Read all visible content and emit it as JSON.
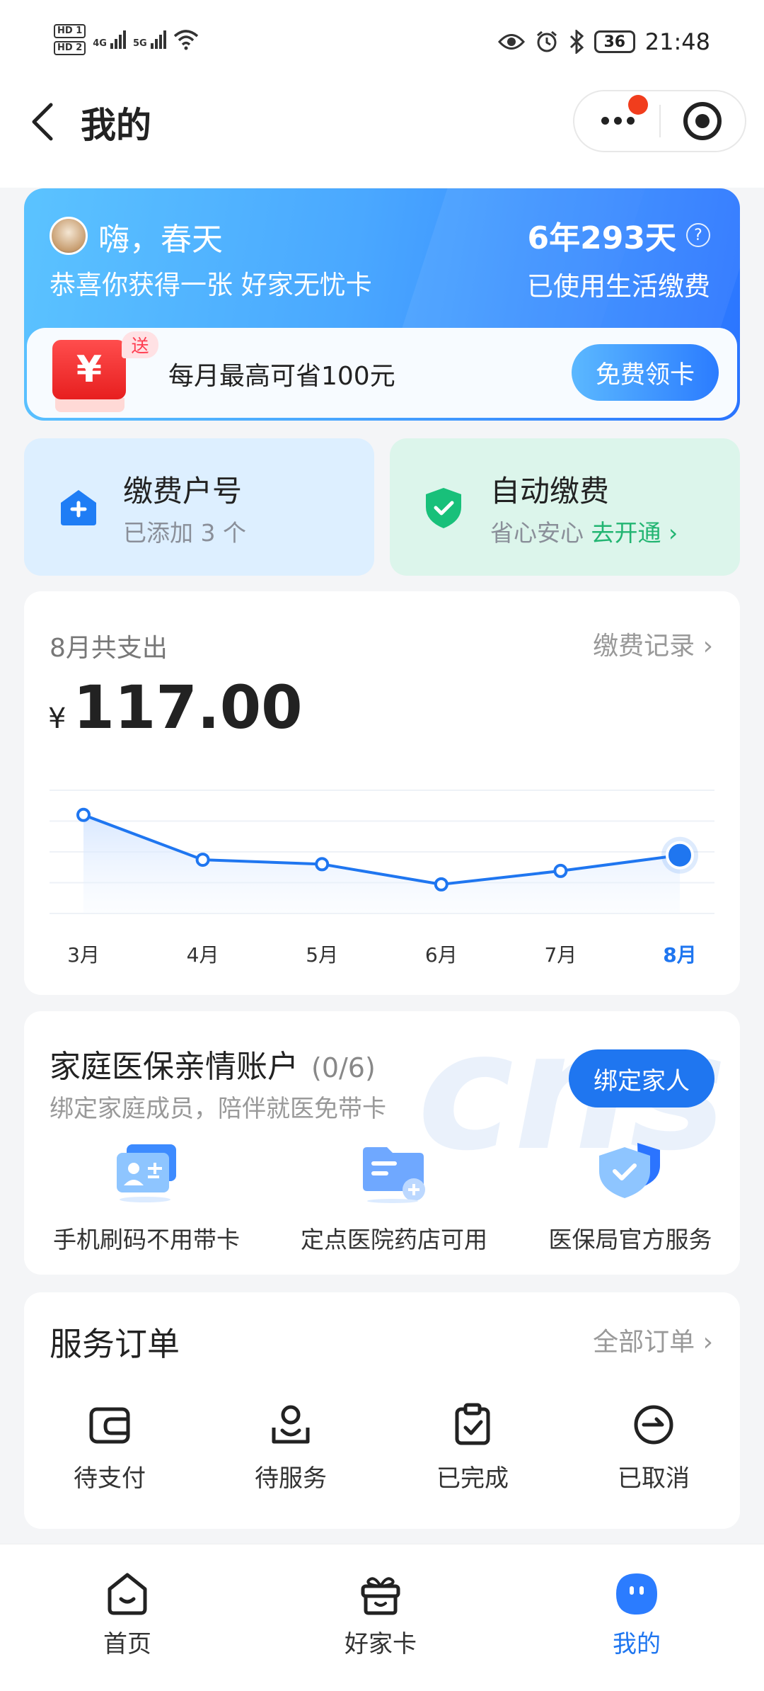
{
  "status_bar": {
    "hd1": "HD 1",
    "hd2": "HD 2",
    "net1": "4G",
    "net2": "5G",
    "battery": "36",
    "time": "21:48",
    "icons": [
      "eye-icon",
      "alarm-icon",
      "bluetooth-icon",
      "wifi-icon"
    ]
  },
  "header": {
    "title": "我的"
  },
  "banner": {
    "greeting": "嗨，春天",
    "congrats": "恭喜你获得一张 好家无忧卡",
    "years": "6年293天",
    "years_sub": "已使用生活缴费",
    "help": "?",
    "promo_tag": "送",
    "promo_yen": "¥",
    "promo_text": "每月最高可省100元",
    "claim_button": "免费领卡"
  },
  "account_card": {
    "title": "缴费户号",
    "sub": "已添加 3 个"
  },
  "auto_card": {
    "title": "自动缴费",
    "sub": "省心安心 ",
    "link": "去开通"
  },
  "spend": {
    "label": "8月共支出",
    "records_link": "缴费记录",
    "currency": "¥",
    "amount": "117.00"
  },
  "chart_data": {
    "type": "line",
    "categories": [
      "3月",
      "4月",
      "5月",
      "6月",
      "7月",
      "8月"
    ],
    "series": [
      {
        "values": [
          44,
          24,
          22,
          13,
          19,
          26
        ]
      }
    ],
    "ylim": [
      0,
      55
    ],
    "grid": true,
    "highlight_index": 5,
    "colors": {
      "line": "#1f76f0",
      "active_label": "#1f76f0",
      "label": "#333333"
    }
  },
  "medical": {
    "title": "家庭医保亲情账户",
    "count": "(0/6)",
    "sub": "绑定家庭成员，陪伴就医免带卡",
    "bind_button": "绑定家人",
    "features": [
      {
        "label": "手机刷码不用带卡",
        "icon": "id-card-icon"
      },
      {
        "label": "定点医院药店可用",
        "icon": "folder-plus-icon"
      },
      {
        "label": "医保局官方服务",
        "icon": "shield-check-icon"
      }
    ]
  },
  "orders": {
    "title": "服务订单",
    "all_link": "全部订单",
    "items": [
      {
        "label": "待支付",
        "icon": "wallet-icon"
      },
      {
        "label": "待服务",
        "icon": "user-service-icon"
      },
      {
        "label": "已完成",
        "icon": "clipboard-check-icon"
      },
      {
        "label": "已取消",
        "icon": "cancel-circle-icon"
      }
    ]
  },
  "bottom_nav": {
    "items": [
      {
        "label": "首页",
        "icon": "home-icon"
      },
      {
        "label": "好家卡",
        "icon": "gift-icon"
      },
      {
        "label": "我的",
        "icon": "profile-icon"
      }
    ],
    "active": 2
  }
}
